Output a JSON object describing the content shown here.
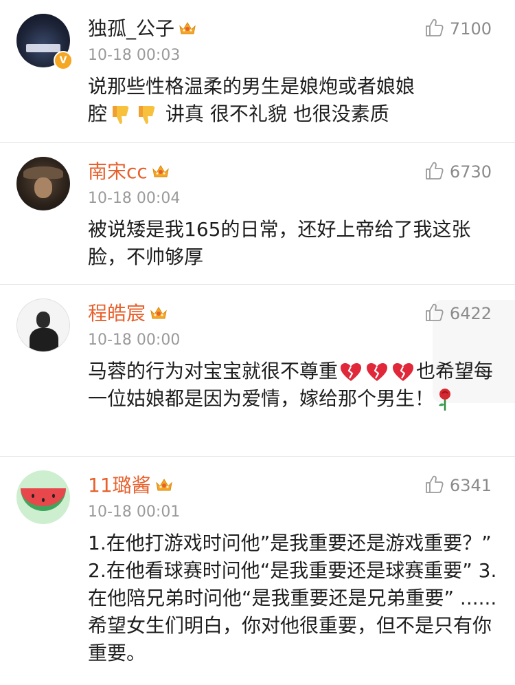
{
  "comments": [
    {
      "username": "独孤_公子",
      "verified_badge": "V",
      "timestamp": "10-18 00:03",
      "likes": "7100",
      "text_a": "说那些性格温柔的男生是娘炮或者娘娘",
      "text_b": "腔",
      "text_c": " 讲真 很不礼貌 也很没素质"
    },
    {
      "username": "南宋cc",
      "timestamp": "10-18 00:04",
      "likes": "6730",
      "text": "被说矮是我165的日常，还好上帝给了我这张脸，不帅够厚"
    },
    {
      "username": "程皓宸",
      "timestamp": "10-18 00:00",
      "likes": "6422",
      "text_a": "马蓉的行为对宝宝就很不尊重",
      "text_b": "也希望每一位姑娘都是因为爱情，嫁给那个男生！"
    },
    {
      "username": "11璐酱",
      "timestamp": "10-18 00:01",
      "likes": "6341",
      "text": "1.在他打游戏时问他”是我重要还是游戏重要？” 2.在他看球赛时问他“是我重要还是球赛重要” 3.在他陪兄弟时问他“是我重要还是兄弟重要” ......希望女生们明白，你对他很重要，但不是只有你重要。"
    }
  ],
  "icons": {
    "like": "thumbs-up-outline-icon",
    "crown": "vip-crown-icon",
    "thumbs_down": "thumbs-down-emoji",
    "broken_heart": "broken-heart-emoji",
    "rose": "rose-emoji"
  },
  "colors": {
    "vip_name": "#e8602c",
    "plain_name": "#222222",
    "meta_gray": "#9a9a9a",
    "crown_gold": "#f5a623"
  }
}
